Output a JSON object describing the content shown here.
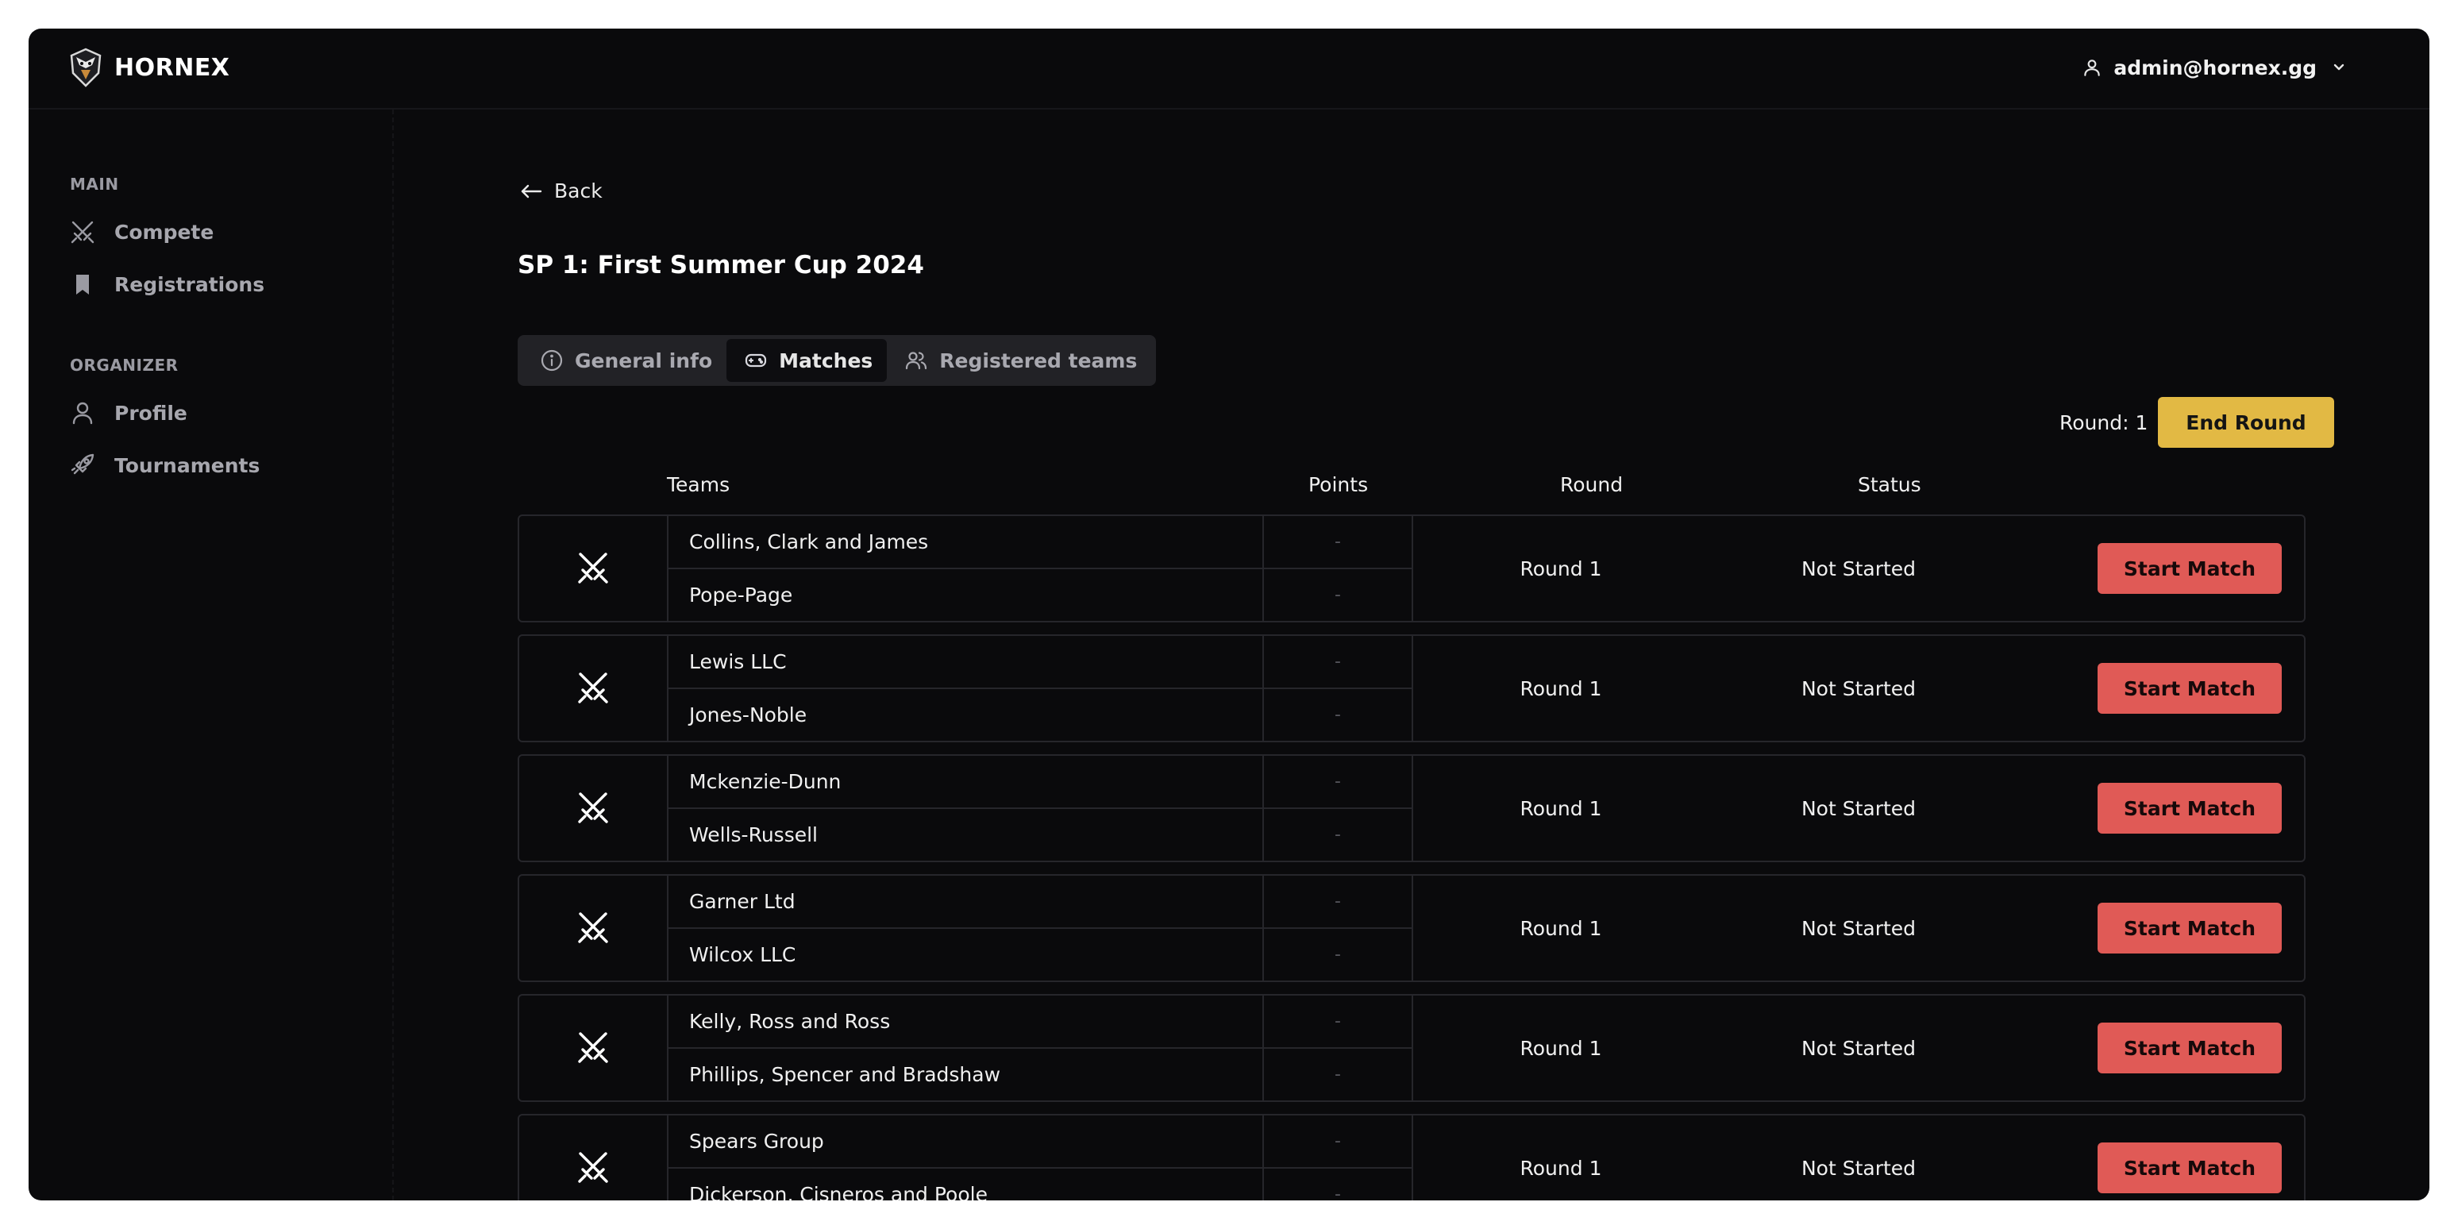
{
  "header": {
    "brand": "HORNEX",
    "user_email": "admin@hornex.gg"
  },
  "sidebar": {
    "sections": [
      {
        "title": "MAIN",
        "items": [
          {
            "label": "Compete",
            "icon": "crossed-swords-icon"
          },
          {
            "label": "Registrations",
            "icon": "bookmark-icon"
          }
        ]
      },
      {
        "title": "ORGANIZER",
        "items": [
          {
            "label": "Profile",
            "icon": "user-icon"
          },
          {
            "label": "Tournaments",
            "icon": "rocket-icon"
          }
        ]
      }
    ]
  },
  "main": {
    "back_label": "Back",
    "title": "SP 1: First Summer Cup 2024",
    "tabs": [
      {
        "label": "General info",
        "icon": "info-icon",
        "active": false
      },
      {
        "label": "Matches",
        "icon": "gamepad-icon",
        "active": true
      },
      {
        "label": "Registered teams",
        "icon": "users-icon",
        "active": false
      }
    ],
    "round_label": "Round: 1",
    "end_round_label": "End Round",
    "columns": {
      "teams": "Teams",
      "points": "Points",
      "round": "Round",
      "status": "Status"
    },
    "matches": [
      {
        "team_a": "Collins, Clark and James",
        "team_b": "Pope-Page",
        "points_a": "-",
        "points_b": "-",
        "round": "Round 1",
        "status": "Not Started",
        "action": "Start Match"
      },
      {
        "team_a": "Lewis LLC",
        "team_b": "Jones-Noble",
        "points_a": "-",
        "points_b": "-",
        "round": "Round 1",
        "status": "Not Started",
        "action": "Start Match"
      },
      {
        "team_a": "Mckenzie-Dunn",
        "team_b": "Wells-Russell",
        "points_a": "-",
        "points_b": "-",
        "round": "Round 1",
        "status": "Not Started",
        "action": "Start Match"
      },
      {
        "team_a": "Garner Ltd",
        "team_b": "Wilcox LLC",
        "points_a": "-",
        "points_b": "-",
        "round": "Round 1",
        "status": "Not Started",
        "action": "Start Match"
      },
      {
        "team_a": "Kelly, Ross and Ross",
        "team_b": "Phillips, Spencer and Bradshaw",
        "points_a": "-",
        "points_b": "-",
        "round": "Round 1",
        "status": "Not Started",
        "action": "Start Match"
      },
      {
        "team_a": "Spears Group",
        "team_b": "Dickerson, Cisneros and Poole",
        "points_a": "-",
        "points_b": "-",
        "round": "Round 1",
        "status": "Not Started",
        "action": "Start Match"
      }
    ]
  },
  "colors": {
    "background": "#0a0a0c",
    "accent_yellow": "#e2b944",
    "start_red": "#e05a56"
  }
}
